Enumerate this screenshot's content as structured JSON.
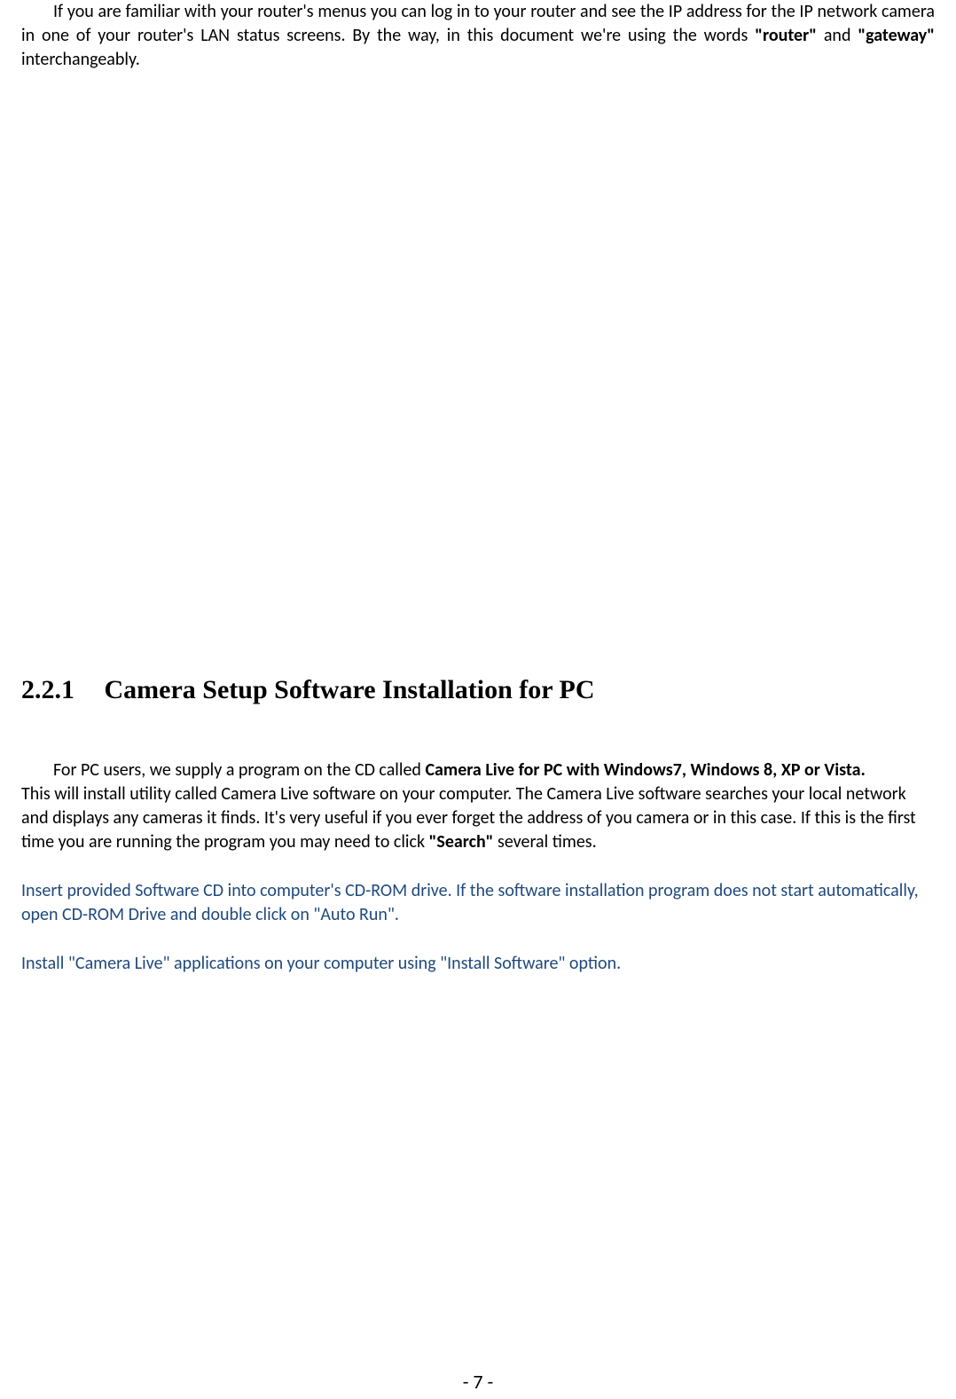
{
  "top": {
    "part1": "If you are familiar with your router's menus you can log in to your router and see the IP address for the IP network camera in one of your router's LAN status screens. By the way, in this document we're using the words ",
    "bold1": "\"router\"",
    "part2": " and ",
    "bold2": "\"gateway\"",
    "part3": " interchangeably."
  },
  "section": {
    "number": "2.2.1",
    "title": "Camera Setup Software Installation for PC"
  },
  "body1": {
    "intro": "For PC users, we supply a program on the CD called ",
    "bold1": "Camera Live for PC with Windows7, Windows 8, XP or Vista."
  },
  "body2": {
    "part1": "This will install utility called Camera Live software on your computer. The Camera Live software searches your local network and displays any cameras it finds. It's very useful if you ever forget the address of you camera or in this case. If this is the first time you are running the program you may need to click ",
    "bold1": "\"Search\"",
    "part2": " several times."
  },
  "blue1": "Insert provided Software CD into computer's CD-ROM drive. If the software installation program does not start automatically, open CD-ROM Drive and double click on \"Auto Run\".",
  "blue2": "Install \"Camera Live\" applications on your computer using \"Install Software\" option.",
  "pageNumber": "- 7 -"
}
